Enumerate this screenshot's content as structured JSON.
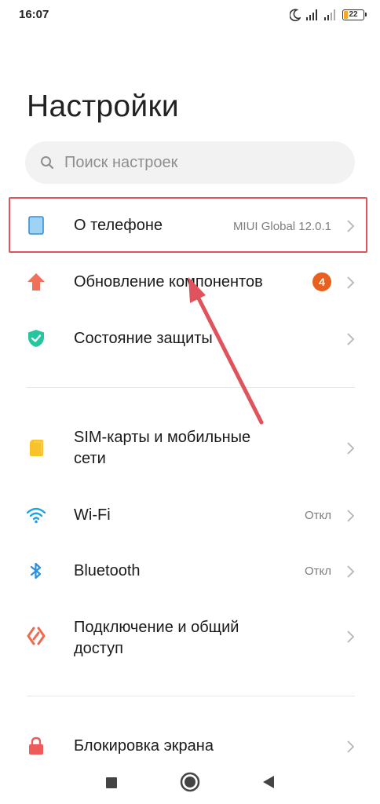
{
  "status_bar": {
    "time": "16:07",
    "battery_level": "22",
    "icons": [
      "moon-icon",
      "signal-icon",
      "signal-icon",
      "battery-icon"
    ]
  },
  "header": {
    "title": "Настройки"
  },
  "search": {
    "placeholder": "Поиск настроек"
  },
  "items": [
    {
      "label": "О телефоне",
      "value": "MIUI Global 12.0.1",
      "icon": "phone-icon",
      "highlighted": true
    },
    {
      "label": "Обновление компонентов",
      "badge": "4",
      "icon": "arrow-up-icon"
    },
    {
      "label": "Состояние защиты",
      "icon": "shield-check-icon"
    },
    {
      "label_line1": "SIM-карты и мобильные",
      "label_line2": "сети",
      "icon": "sim-card-icon"
    },
    {
      "label": "Wi-Fi",
      "value": "Откл",
      "icon": "wifi-icon"
    },
    {
      "label": "Bluetooth",
      "value": "Откл",
      "icon": "bluetooth-icon"
    },
    {
      "label_line1": "Подключение и общий",
      "label_line2": "доступ",
      "icon": "share-icon"
    },
    {
      "label": "Блокировка экрана",
      "icon": "lock-icon"
    }
  ],
  "colors": {
    "highlight_border": "#e0525c",
    "arrow": "#e0525c",
    "badge": "#e8601e",
    "update_icon": "#f0705a",
    "shield": "#25c69e",
    "sim": "#f7c22a",
    "wifi": "#1da4e4",
    "bluetooth": "#2a8ee0",
    "share": "#ef6b4f",
    "lock": "#ef5b5b"
  },
  "nav_bar": {
    "buttons": [
      "recents-square-icon",
      "home-circle-icon",
      "back-triangle-icon"
    ]
  }
}
